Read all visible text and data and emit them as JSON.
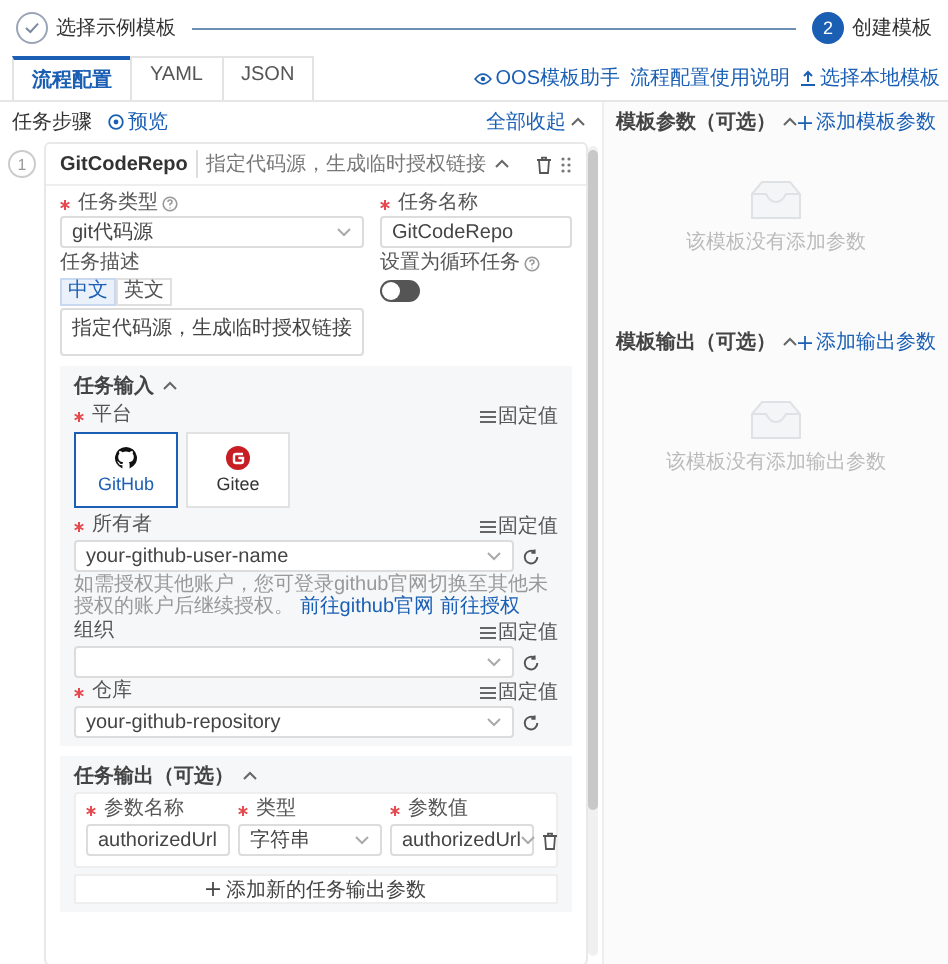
{
  "stepper": [
    {
      "label": "选择示例模板",
      "done": true
    },
    {
      "index": "2",
      "label": "创建模板",
      "done": false
    }
  ],
  "tabs": [
    {
      "label": "流程配置",
      "selected": true
    },
    {
      "label": "YAML",
      "selected": false
    },
    {
      "label": "JSON",
      "selected": false
    }
  ],
  "toolbar_links": [
    {
      "label": "OOS模板助手"
    },
    {
      "label": "流程配置使用说明"
    },
    {
      "label": "选择本地模板"
    }
  ],
  "tasks_panel": {
    "title": "任务步骤",
    "preview": "预览",
    "collapse_all": "全部收起"
  },
  "task": {
    "number": "1",
    "name": "GitCodeRepo",
    "description": "指定代码源，生成临时授权链接",
    "type_field": {
      "label": "任务类型",
      "required": true,
      "value": "git代码源"
    },
    "name_field": {
      "label": "任务名称",
      "required": true,
      "value": "GitCodeRepo"
    },
    "desc_field": {
      "label": "任务描述",
      "langs": [
        {
          "label": "中文",
          "selected": true
        },
        {
          "label": "英文",
          "selected": false
        }
      ],
      "value": "指定代码源，生成临时授权链接"
    },
    "loop": {
      "label": "设置为循环任务",
      "on": false
    },
    "inputs": {
      "title": "任务输入",
      "platform": {
        "label": "平台",
        "required": true,
        "fixed": "固定值",
        "options": [
          {
            "label": "GitHub",
            "selected": true
          },
          {
            "label": "Gitee",
            "selected": false
          }
        ]
      },
      "params": [
        {
          "label": "所有者",
          "required": true,
          "value": "your-github-user-name",
          "fixed": "固定值",
          "hint": "如需授权其他账户，您可登录github官网切换至其他未授权的账户后继续授权。",
          "links": [
            "前往github官网",
            "前往授权"
          ]
        },
        {
          "label": "组织",
          "required": false,
          "fixed": "固定值"
        },
        {
          "label": "仓库",
          "required": true,
          "value": "your-github-repository",
          "fixed": "固定值"
        }
      ]
    },
    "outputs": {
      "title": "任务输出（可选）",
      "columns": [
        {
          "label": "参数名称",
          "required": true
        },
        {
          "label": "类型",
          "required": true
        },
        {
          "label": "参数值",
          "required": true
        }
      ],
      "rows": [
        {
          "name": "authorizedUrl",
          "type": "字符串",
          "value": "authorizedUrl"
        }
      ],
      "add": "添加新的任务输出参数"
    }
  },
  "template_params": {
    "title": "模板参数（可选）",
    "add": "添加模板参数",
    "empty": "该模板没有添加参数"
  },
  "template_outputs": {
    "title": "模板输出（可选）",
    "add": "添加输出参数",
    "empty": "该模板没有添加输出参数"
  }
}
